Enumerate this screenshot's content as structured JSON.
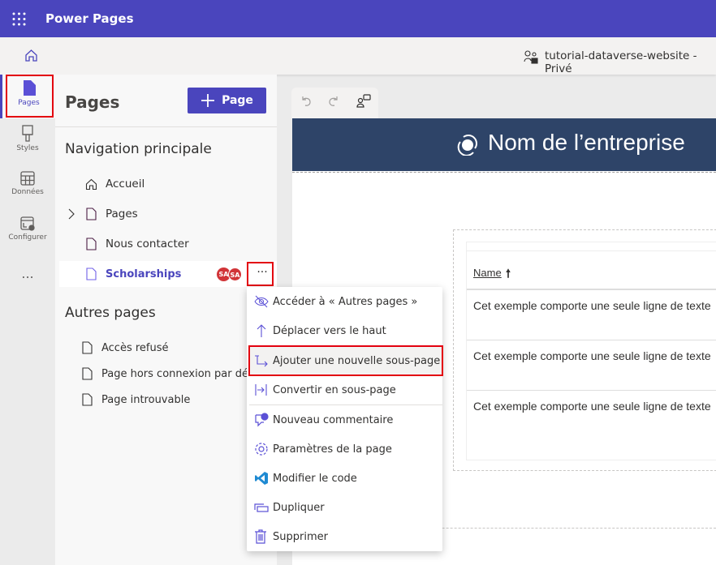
{
  "app": {
    "title": "Power Pages"
  },
  "subbar": {
    "site": "tutorial-dataverse-website - Privé"
  },
  "rail": [
    {
      "label": "Pages"
    },
    {
      "label": "Styles"
    },
    {
      "label": "Données"
    },
    {
      "label": "Configurer"
    },
    {
      "label": "..."
    }
  ],
  "panel": {
    "title": "Pages",
    "add_button": "Page",
    "main_nav_heading": "Navigation principale",
    "main_nav": [
      {
        "label": "Accueil"
      },
      {
        "label": "Pages"
      },
      {
        "label": "Nous contacter"
      },
      {
        "label": "Scholarships"
      }
    ],
    "badges": [
      "SA",
      "SA"
    ],
    "other_heading": "Autres pages",
    "other": [
      {
        "label": "Accès refusé"
      },
      {
        "label": "Page hors connexion par défaut"
      },
      {
        "label": "Page introuvable"
      }
    ]
  },
  "menu": [
    {
      "label": "Accéder à « Autres pages »"
    },
    {
      "label": "Déplacer vers le haut"
    },
    {
      "label": "Ajouter une nouvelle sous-page"
    },
    {
      "label": "Convertir en sous-page"
    },
    {
      "label": "Nouveau commentaire"
    },
    {
      "label": "Paramètres de la page"
    },
    {
      "label": "Modifier le code"
    },
    {
      "label": "Dupliquer"
    },
    {
      "label": "Supprimer"
    }
  ],
  "site": {
    "company": "Nom de l’entreprise",
    "table_header": "Name",
    "rows": [
      "Cet exemple comporte une seule ligne de texte",
      "Cet exemple comporte une seule ligne de texte",
      "Cet exemple comporte une seule ligne de texte"
    ]
  },
  "colors": {
    "brand": "#4a45bd",
    "site_header": "#2e4468",
    "badge": "#d13438",
    "highlight": "#e3000f"
  }
}
